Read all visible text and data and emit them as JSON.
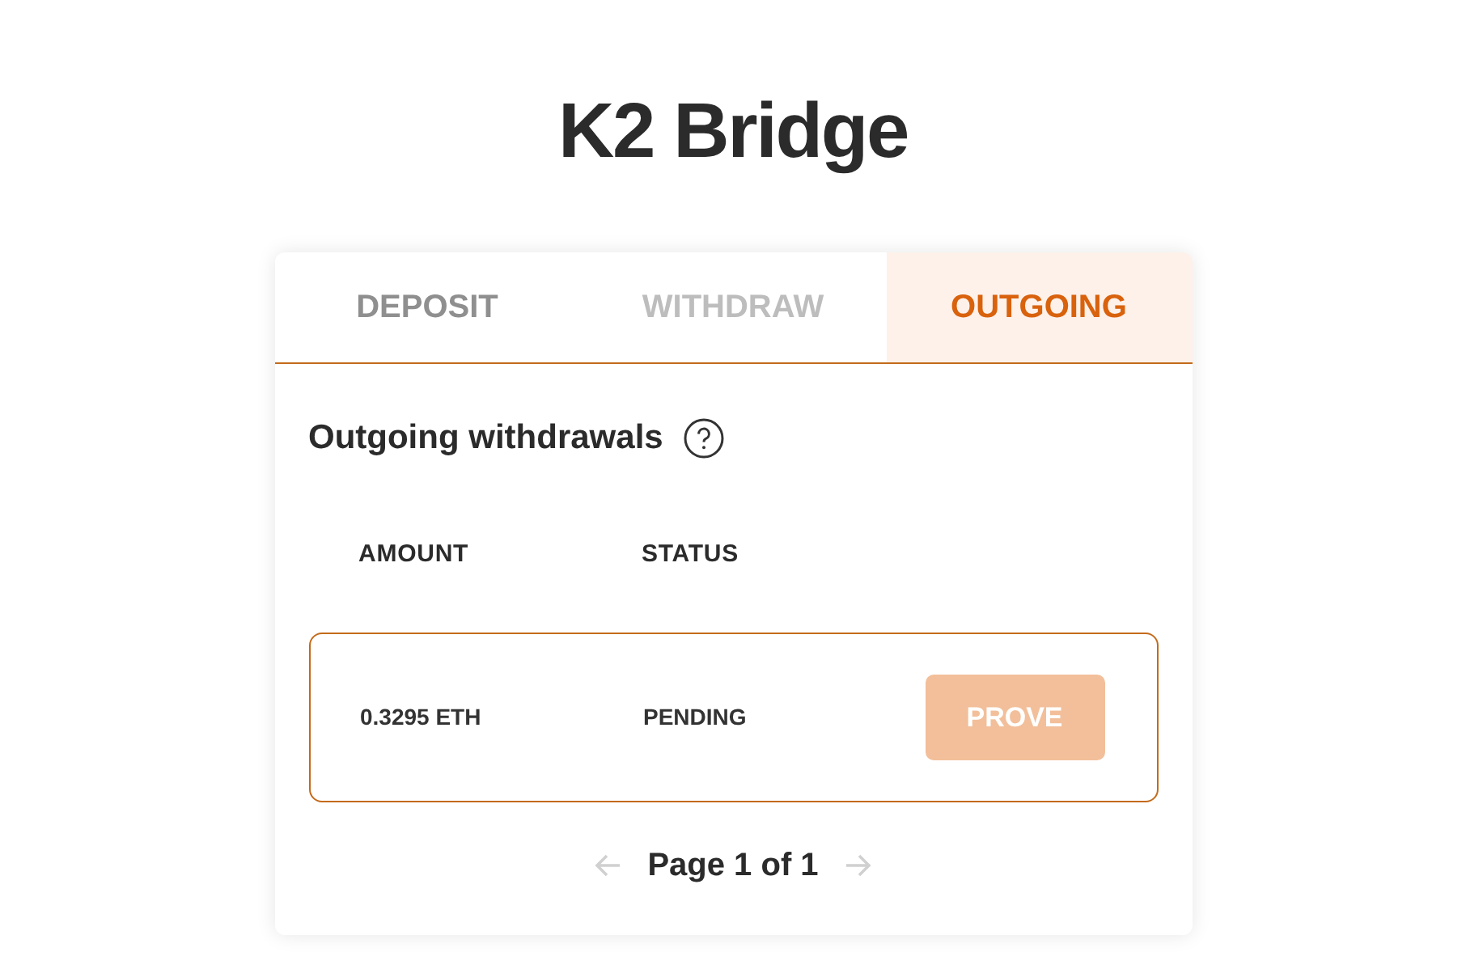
{
  "title": "K2 Bridge",
  "tabs": [
    {
      "label": "DEPOSIT",
      "selected": false,
      "disabled": false
    },
    {
      "label": "WITHDRAW",
      "selected": false,
      "disabled": true
    },
    {
      "label": "OUTGOING",
      "selected": true,
      "disabled": false
    }
  ],
  "heading": "Outgoing withdrawals",
  "columns": [
    "AMOUNT",
    "STATUS"
  ],
  "rows": [
    {
      "amount": "0.3295 ETH",
      "status": "PENDING",
      "action": {
        "label": "PROVE",
        "disabled": true
      }
    }
  ],
  "pagination": {
    "label": "Page 1 of 1",
    "prev_disabled": true,
    "next_disabled": true
  }
}
